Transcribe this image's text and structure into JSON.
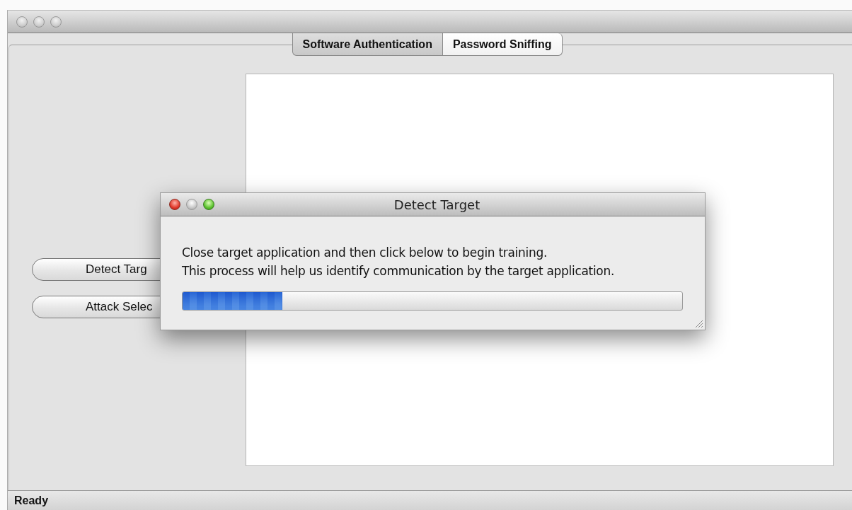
{
  "tabs": [
    {
      "label": "Software Authentication",
      "selected": true
    },
    {
      "label": "Password Sniffing",
      "selected": false
    }
  ],
  "side_buttons": [
    "Detect Targ",
    "Attack Selec"
  ],
  "status_bar": "Ready",
  "dialog": {
    "title": "Detect Target",
    "message": [
      "Close target application and then click below to begin training.",
      "This process will help us identify communication by the target application."
    ],
    "progress": {
      "level": 0.2
    }
  }
}
